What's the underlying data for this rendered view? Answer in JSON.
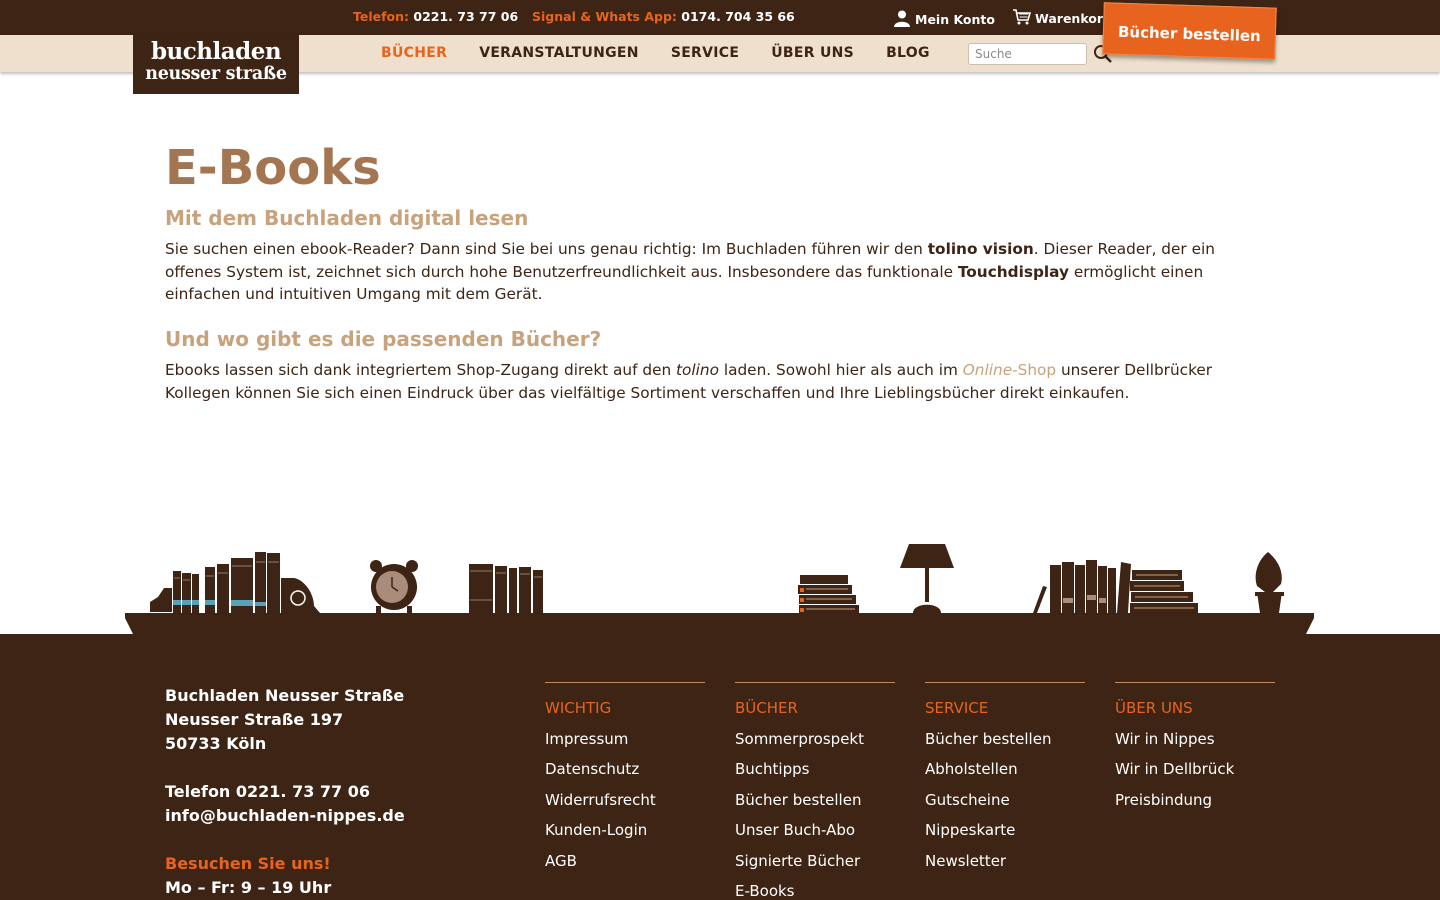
{
  "topbar": {
    "phone_label": "Telefon:",
    "phone_number": "0221. 73 77 06",
    "messenger_label": "Signal & Whats App:",
    "messenger_number": "0174. 704 35 66",
    "account_label": "Mein Konto",
    "cart_label": "Warenkorb",
    "account_icon": "user-icon",
    "cart_icon": "cart-icon"
  },
  "logo": {
    "line1": "buchladen",
    "line2": "neusser straße"
  },
  "order_button": "Bücher bestellen",
  "nav": {
    "items": [
      {
        "label": "BÜCHER",
        "active": true
      },
      {
        "label": "VERANSTALTUNGEN",
        "active": false
      },
      {
        "label": "SERVICE",
        "active": false
      },
      {
        "label": "ÜBER UNS",
        "active": false
      },
      {
        "label": "BLOG",
        "active": false
      }
    ],
    "search_placeholder": "Suche",
    "search_icon": "search-icon"
  },
  "main": {
    "title": "E-Books",
    "section1": {
      "heading": "Mit dem Buchladen digital lesen",
      "text_a": "Sie suchen einen ebook-Reader? Dann sind Sie bei uns genau richtig: Im Buchladen führen wir den ",
      "bold_a": "tolino vision",
      "text_b": ". Dieser Reader, der ein offenes System ist, zeichnet sich durch hohe Benutzerfreundlichkeit aus. Insbesondere das funktionale ",
      "bold_b": "Touchdisplay",
      "text_c": " ermöglicht einen einfachen und intuitiven Umgang mit dem Gerät."
    },
    "section2": {
      "heading": "Und wo gibt es die passenden Bücher?",
      "text_a": "Ebooks lassen sich dank integriertem Shop-Zugang direkt auf den ",
      "italic_a": "tolino",
      "text_b": " laden. Sowohl hier als auch im ",
      "link_label": "Online-",
      "link_rest": "Shop",
      "text_c": " unserer Dellbrücker Kollegen können Sie sich einen Eindruck über das vielfältige Sortiment verschaffen und Ihre Lieblingsbücher direkt einkaufen."
    }
  },
  "footer": {
    "address": {
      "name": "Buchladen Neusser Straße",
      "street": "Neusser Straße 197",
      "city": "50733 Köln",
      "phone": "Telefon 0221. 73 77 06",
      "email": "info@buchladen-nippes.de",
      "visit_heading": "Besuchen Sie uns!",
      "hours": "Mo – Fr: 9 – 19 Uhr"
    },
    "columns": [
      {
        "title": "WICHTIG",
        "links": [
          "Impressum",
          "Datenschutz",
          "Widerrufsrecht",
          "Kunden-Login",
          "AGB"
        ]
      },
      {
        "title": "BÜCHER",
        "links": [
          "Sommerprospekt",
          "Buchtipps",
          "Bücher bestellen",
          "Unser Buch-Abo",
          "Signierte Bücher",
          "E-Books"
        ]
      },
      {
        "title": "SERVICE",
        "links": [
          "Bücher bestellen",
          "Abholstellen",
          "Gutscheine",
          "Nippeskarte",
          "Newsletter"
        ]
      },
      {
        "title": "ÜBER UNS",
        "links": [
          "Wir in Nippes",
          "Wir in Dellbrück",
          "Preisbindung"
        ]
      }
    ]
  },
  "colors": {
    "dark_brown": "#3d2414",
    "orange": "#e8641e",
    "beige_nav": "#eee0cd",
    "title_brown": "#a47551",
    "heading_tan": "#c7a27c"
  }
}
